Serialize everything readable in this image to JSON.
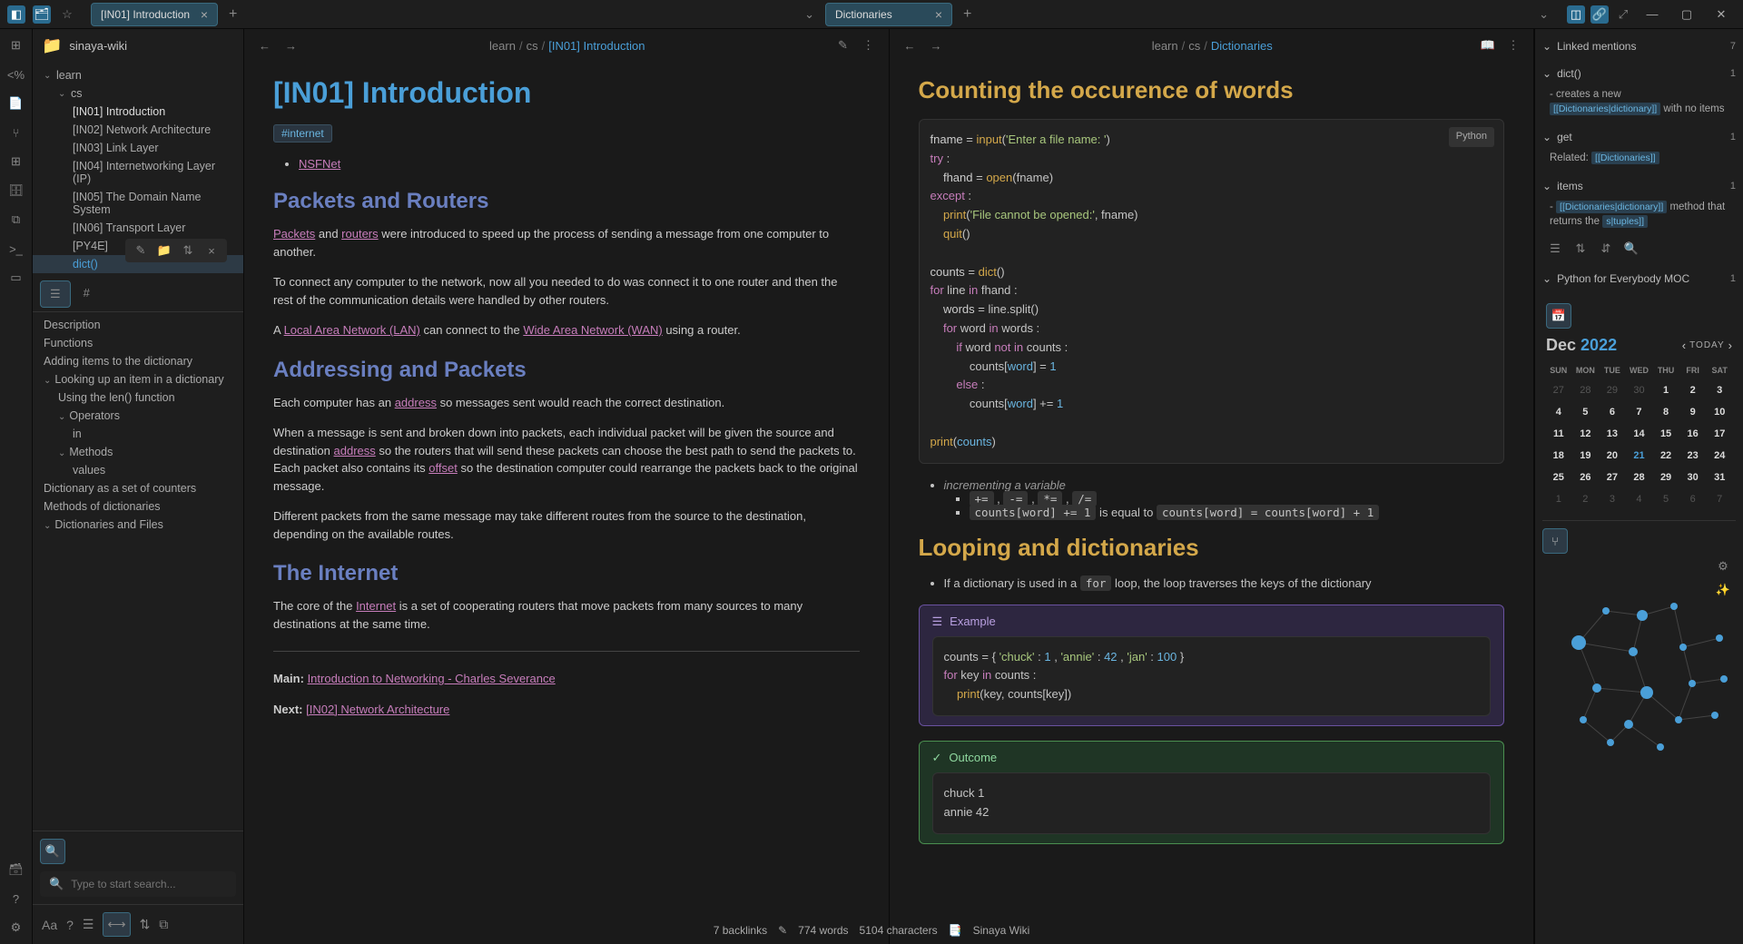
{
  "titlebar": {
    "tab1": "[IN01] Introduction",
    "tab2": "Dictionaries"
  },
  "vault": {
    "name": "sinaya-wiki"
  },
  "tree": {
    "learn": "learn",
    "cs": "cs",
    "items": [
      "[IN01] Introduction",
      "[IN02] Network Architecture",
      "[IN03] Link Layer",
      "[IN04] Internetworking Layer (IP)",
      "[IN05] The Domain Name System",
      "[IN06] Transport Layer",
      "[PY4E]",
      "dict()"
    ]
  },
  "outline": {
    "items": [
      "Description",
      "Functions",
      "Adding items to the dictionary",
      "Looking up an item in a dictionary",
      "Using the len() function",
      "Operators",
      "in",
      "Methods",
      "values",
      "Dictionary as a set of counters",
      "Methods of dictionaries",
      "Dictionaries and Files"
    ]
  },
  "search": {
    "placeholder": "Type to start search..."
  },
  "pane1": {
    "bc": {
      "p1": "learn",
      "p2": "cs",
      "p3": "[IN01] Introduction"
    },
    "title": "[IN01] Introduction",
    "tag": "#internet",
    "link_nsfnet": "NSFNet",
    "h2_packets": "Packets and Routers",
    "link_packets": "Packets",
    "txt_and": " and ",
    "link_routers": "routers",
    "p1_rest": " were introduced to speed up the process of sending a message from one computer to another.",
    "p2": "To connect any computer to the network, now all you needed to do was connect it to one router and then the rest of the communication details were handled by other routers.",
    "p3_a": "A ",
    "link_lan": "Local Area Network (LAN)",
    "p3_mid": " can connect to the ",
    "link_wan": "Wide Area Network (WAN)",
    "p3_end": " using a router.",
    "h2_addr": "Addressing and Packets",
    "p4_a": "Each computer has an ",
    "link_addr": "address",
    "p4_end": " so messages sent would reach the correct destination.",
    "p5_a": "When a message is sent and broken down into packets, each individual packet will be given the source and destination ",
    "p5_mid": " so the routers that will send these packets can choose the best path to send the packets to. Each packet also contains its ",
    "link_offset": "offset",
    "p5_end": " so the destination computer could rearrange the packets back to the original message.",
    "p6": "Different packets from the same message may take different routes from the source to the destination, depending on the available routes.",
    "h2_inet": "The Internet",
    "p7_a": "The core of the ",
    "link_internet": "Internet",
    "p7_end": " is a set of cooperating routers that move packets from many sources to many destinations at the same time.",
    "main_label": "Main: ",
    "main_link": "Introduction to Networking - Charles Severance",
    "next_label": "Next: ",
    "next_link": "[IN02] Network Architecture"
  },
  "pane2": {
    "bc": {
      "p1": "learn",
      "p2": "cs",
      "p3": "Dictionaries"
    },
    "h2_count": "Counting the occurence of words",
    "code_lang": "Python",
    "l1_item1": "incrementing a variable",
    "ops": {
      "a": "+=",
      "b": "-=",
      "c": "*=",
      "d": "/="
    },
    "eq_pre": "counts[word] += 1",
    "eq_mid": " is equal to ",
    "eq_post": "counts[word] = counts[word] + 1",
    "h2_loop": "Looping and dictionaries",
    "loop_p_a": "If a dictionary is used in a ",
    "loop_for": "for",
    "loop_p_b": " loop, the loop traverses the keys of the dictionary",
    "callout_example": "Example",
    "callout_outcome": "Outcome",
    "outcome_l1": "chuck 1",
    "outcome_l2": "annie 42"
  },
  "rightbar": {
    "linked": {
      "label": "Linked mentions",
      "count": "7"
    },
    "dict": {
      "label": "dict()",
      "count": "1",
      "text": "- creates a new",
      "link": "[[Dictionaries|dictionary]]",
      "rest": "with no items"
    },
    "get": {
      "label": "get",
      "count": "1",
      "text": "Related:",
      "link": "[[Dictionaries]]"
    },
    "items": {
      "label": "items",
      "count": "1",
      "text": "-",
      "link": "[[Dictionaries|dictionary]]",
      "rest": "method that returns the",
      "link2": "s|tuples]]"
    },
    "py4e": {
      "label": "Python for Everybody MOC",
      "count": "1"
    }
  },
  "calendar": {
    "month": "Dec",
    "year": "2022",
    "today": "TODAY",
    "dow": [
      "SUN",
      "MON",
      "TUE",
      "WED",
      "THU",
      "FRI",
      "SAT"
    ],
    "days": [
      {
        "n": "27",
        "o": true
      },
      {
        "n": "28",
        "o": true
      },
      {
        "n": "29",
        "o": true
      },
      {
        "n": "30",
        "o": true
      },
      {
        "n": "1",
        "b": true
      },
      {
        "n": "2",
        "b": true
      },
      {
        "n": "3",
        "b": true
      },
      {
        "n": "4",
        "b": true
      },
      {
        "n": "5",
        "b": true
      },
      {
        "n": "6",
        "b": true
      },
      {
        "n": "7",
        "b": true
      },
      {
        "n": "8",
        "b": true
      },
      {
        "n": "9",
        "b": true
      },
      {
        "n": "10",
        "b": true
      },
      {
        "n": "11",
        "b": true
      },
      {
        "n": "12",
        "b": true
      },
      {
        "n": "13",
        "b": true
      },
      {
        "n": "14",
        "b": true
      },
      {
        "n": "15",
        "b": true
      },
      {
        "n": "16",
        "b": true
      },
      {
        "n": "17",
        "b": true
      },
      {
        "n": "18",
        "b": true
      },
      {
        "n": "19",
        "b": true
      },
      {
        "n": "20",
        "b": true
      },
      {
        "n": "21",
        "t": true
      },
      {
        "n": "22",
        "b": true
      },
      {
        "n": "23",
        "b": true
      },
      {
        "n": "24",
        "b": true
      },
      {
        "n": "25",
        "b": true
      },
      {
        "n": "26",
        "b": true
      },
      {
        "n": "27",
        "b": true
      },
      {
        "n": "28",
        "b": true
      },
      {
        "n": "29",
        "b": true
      },
      {
        "n": "30",
        "b": true
      },
      {
        "n": "31",
        "b": true
      },
      {
        "n": "1",
        "o": true
      },
      {
        "n": "2",
        "o": true
      },
      {
        "n": "3",
        "o": true
      },
      {
        "n": "4",
        "o": true
      },
      {
        "n": "5",
        "o": true
      },
      {
        "n": "6",
        "o": true
      },
      {
        "n": "7",
        "o": true
      }
    ]
  },
  "status": {
    "backlinks": "7 backlinks",
    "words": "774 words",
    "chars": "5104 characters",
    "wiki": "Sinaya Wiki"
  }
}
